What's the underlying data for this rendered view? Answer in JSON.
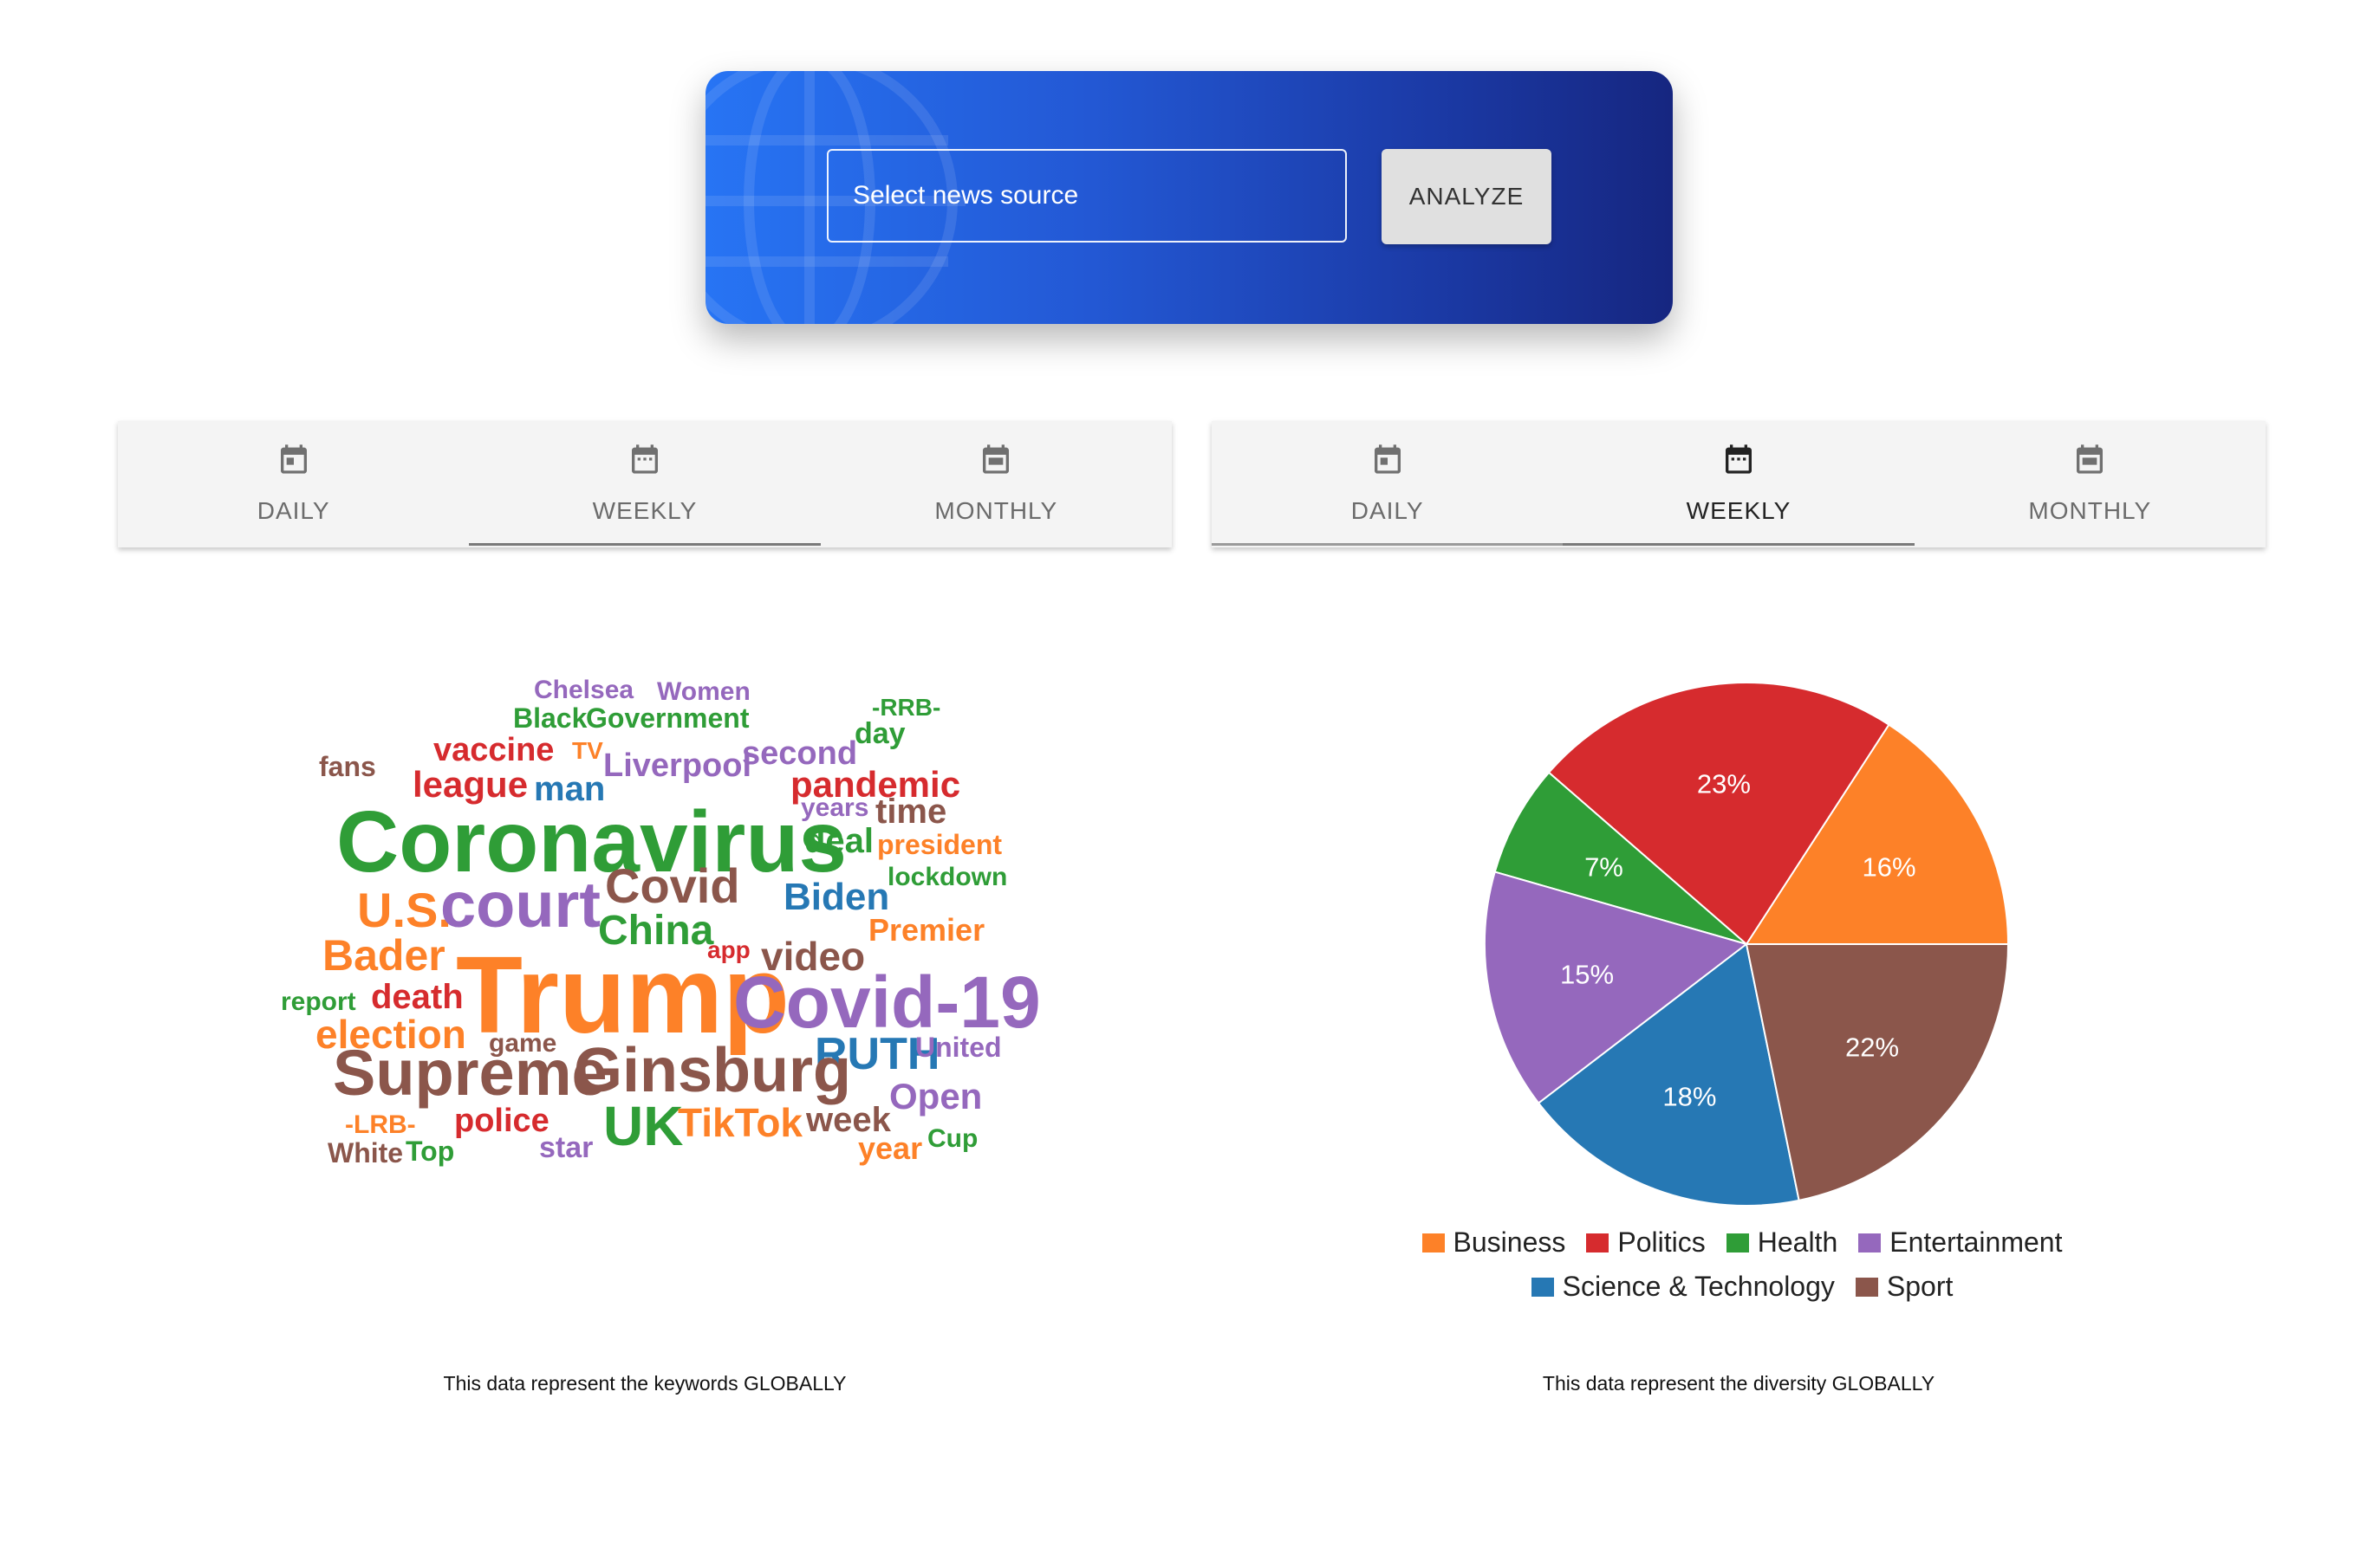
{
  "search": {
    "placeholder": "Select news source",
    "analyze_label": "ANALYZE"
  },
  "left_tabs": {
    "items": [
      {
        "label": "DAILY",
        "icon": "calendar-icon",
        "active": false
      },
      {
        "label": "WEEKLY",
        "icon": "calendar-icon",
        "active": true
      },
      {
        "label": "MONTHLY",
        "icon": "calendar-icon",
        "active": false
      }
    ]
  },
  "right_tabs": {
    "items": [
      {
        "label": "DAILY",
        "icon": "calendar-icon",
        "active": false
      },
      {
        "label": "WEEKLY",
        "icon": "calendar-icon",
        "active": true
      },
      {
        "label": "MONTHLY",
        "icon": "calendar-icon",
        "active": false
      }
    ]
  },
  "wordcloud": {
    "caption": "This data represent the keywords GLOBALLY",
    "words": [
      "Chelsea",
      "Women",
      "Black",
      "Government",
      "-RRB-",
      "vaccine",
      "TV",
      "Liverpool",
      "second",
      "day",
      "fans",
      "league",
      "man",
      "pandemic",
      "Coronavirus",
      "years",
      "time",
      "deal",
      "president",
      "lockdown",
      "U.S.",
      "court",
      "Covid",
      "Biden",
      "China",
      "Premier",
      "Bader",
      "app",
      "video",
      "Trump",
      "report",
      "death",
      "Covid-19",
      "election",
      "game",
      "RUTH",
      "United",
      "Supreme",
      "Ginsburg",
      "Open",
      "-LRB-",
      "police",
      "UK",
      "TikTok",
      "week",
      "Cup",
      "White",
      "Top",
      "star",
      "year"
    ]
  },
  "pie": {
    "caption": "This data represent the diversity GLOBALLY"
  },
  "chart_data": {
    "type": "pie",
    "categories": [
      "Business",
      "Politics",
      "Health",
      "Entertainment",
      "Science & Technology",
      "Sport"
    ],
    "values": [
      16,
      23,
      7,
      15,
      18,
      22
    ],
    "colors": [
      "#fd8128",
      "#d62b2e",
      "#2f9d37",
      "#9568bd",
      "#2678b4",
      "#8b564b"
    ],
    "title": "",
    "legend": "bottom"
  }
}
